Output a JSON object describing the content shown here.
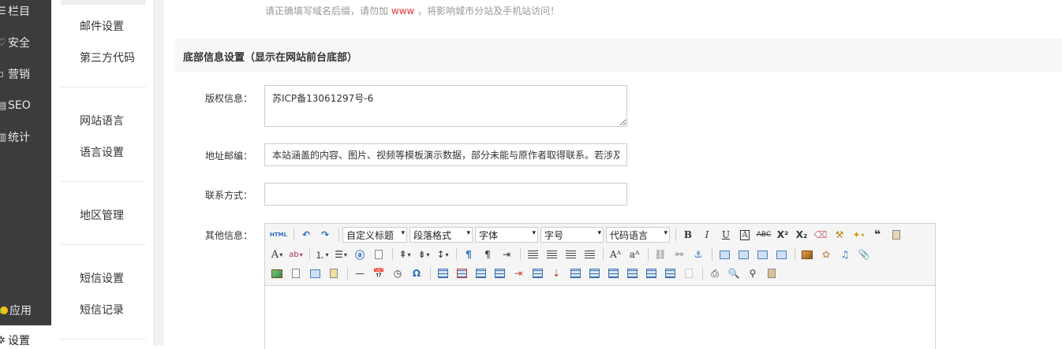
{
  "left_rail": {
    "items": [
      {
        "label": "栏目",
        "icon": "menu-icon"
      },
      {
        "label": "安全",
        "icon": "shield-icon"
      },
      {
        "label": "营销",
        "icon": "marketing-icon"
      },
      {
        "label": "SEO",
        "icon": "seo-icon"
      },
      {
        "label": "统计",
        "icon": "bar-chart-icon"
      },
      {
        "label": "应用",
        "icon": "apps-icon"
      },
      {
        "label": "设置",
        "icon": "gear-icon"
      }
    ]
  },
  "submenu": {
    "items": [
      "邮件设置",
      "第三方代码",
      "网站语言",
      "语言设置",
      "地区管理",
      "短信设置",
      "短信记录"
    ]
  },
  "tip": {
    "before": "请正确填写域名后缀，请勿加",
    "highlight": "www",
    "after": "，将影响城市分站及手机站访问！"
  },
  "section": {
    "title": "底部信息设置（显示在网站前台底部）"
  },
  "form": {
    "copyright": {
      "label": "版权信息：",
      "value": "苏ICP备13061297号-6"
    },
    "address": {
      "label": "地址邮编：",
      "value": "本站涵盖的内容、图片、视频等模板演示数据，部分未能与原作者取得联系。若涉及版权问题，请及时通知我们"
    },
    "contact": {
      "label": "联系方式：",
      "value": ""
    },
    "other": {
      "label": "其他信息："
    }
  },
  "editor": {
    "html_label": "HTML",
    "custom_title": "自定义标题",
    "paragraph_format": "段落格式",
    "font_family": "字体",
    "font_size": "字号",
    "code_language": "代码语言"
  }
}
